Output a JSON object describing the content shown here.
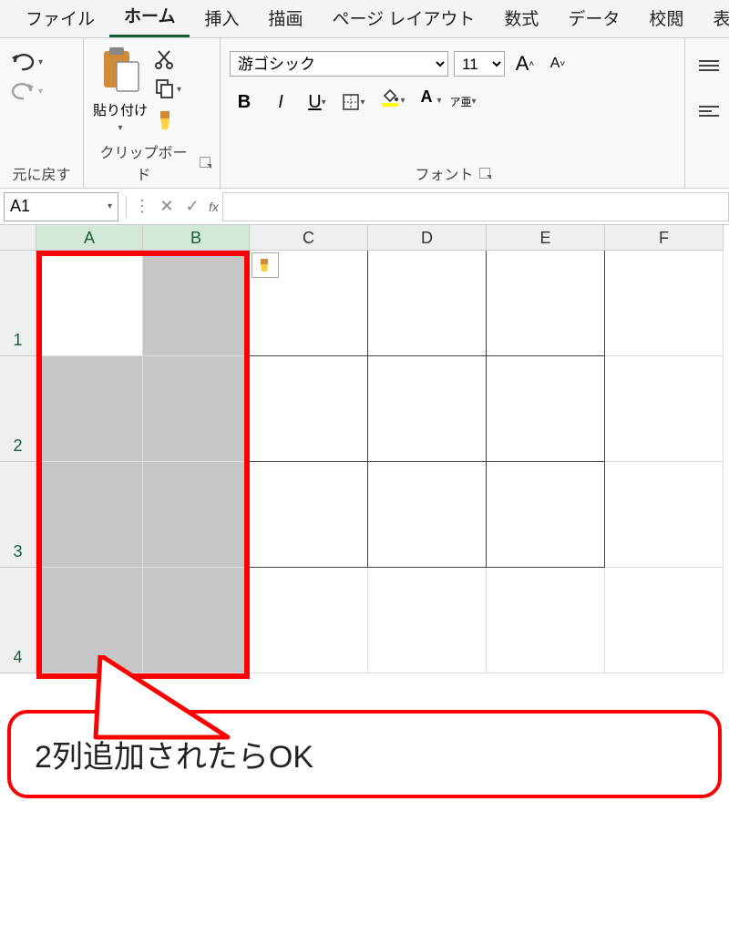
{
  "tabs": {
    "file": "ファイル",
    "home": "ホーム",
    "insert": "挿入",
    "draw": "描画",
    "page_layout": "ページ レイアウト",
    "formulas": "数式",
    "data": "データ",
    "review": "校閲",
    "view_partial": "表"
  },
  "ribbon": {
    "undo_group": "元に戻す",
    "clipboard": {
      "label": "クリップボード",
      "paste": "貼り付け"
    },
    "font": {
      "label": "フォント",
      "name_value": "游ゴシック",
      "size_value": "11",
      "bold": "B",
      "italic": "I",
      "underline": "U",
      "phonetic": "ア亜"
    }
  },
  "name_box": "A1",
  "fx_label": "fx",
  "formula_value": "",
  "columns": [
    "A",
    "B",
    "C",
    "D",
    "E",
    "F"
  ],
  "rows": [
    "1",
    "2",
    "3",
    "4"
  ],
  "callout_text": "2列追加されたらOK"
}
